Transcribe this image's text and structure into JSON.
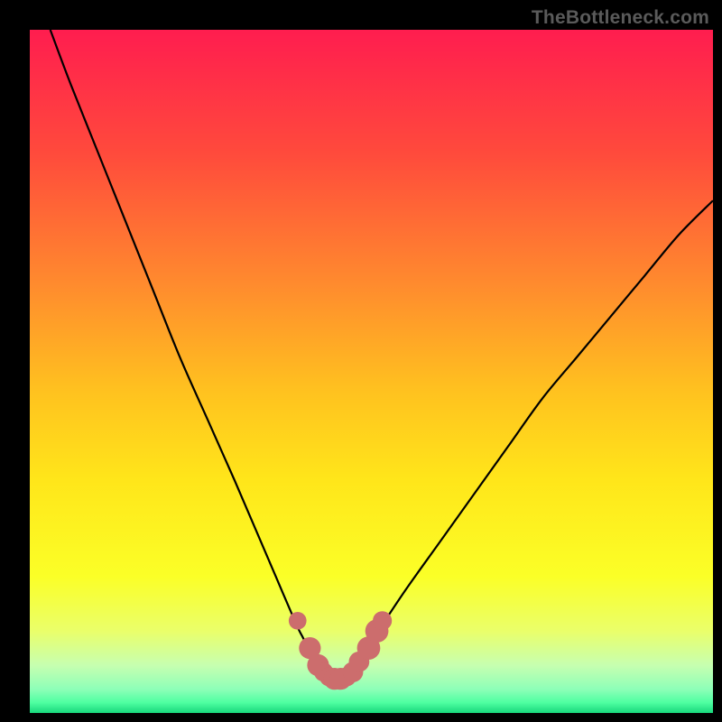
{
  "watermark": "TheBottleneck.com",
  "chart_data": {
    "type": "line",
    "title": "",
    "xlabel": "",
    "ylabel": "",
    "xlim": [
      0,
      100
    ],
    "ylim": [
      0,
      100
    ],
    "grid": false,
    "series": [
      {
        "name": "bottleneck-curve",
        "x": [
          3,
          6,
          10,
          14,
          18,
          22,
          26,
          30,
          33,
          36,
          39,
          40,
          41,
          42,
          43,
          44,
          45,
          46,
          47,
          48,
          49,
          51,
          55,
          60,
          65,
          70,
          75,
          80,
          85,
          90,
          95,
          100
        ],
        "y": [
          100,
          92,
          82,
          72,
          62,
          52,
          43,
          34,
          27,
          20,
          13,
          11,
          9,
          7,
          6,
          5,
          5,
          5,
          6,
          7,
          9,
          12,
          18,
          25,
          32,
          39,
          46,
          52,
          58,
          64,
          70,
          75
        ],
        "color": "#000000"
      }
    ],
    "markers": {
      "name": "highlighted-points",
      "color": "#cc6d6d",
      "points": [
        {
          "x": 39.2,
          "y": 13.5,
          "r": 1.3
        },
        {
          "x": 41.0,
          "y": 9.5,
          "r": 1.6
        },
        {
          "x": 42.2,
          "y": 7.0,
          "r": 1.6
        },
        {
          "x": 43.0,
          "y": 6.0,
          "r": 1.4
        },
        {
          "x": 43.8,
          "y": 5.3,
          "r": 1.4
        },
        {
          "x": 44.6,
          "y": 5.0,
          "r": 1.6
        },
        {
          "x": 45.5,
          "y": 5.0,
          "r": 1.6
        },
        {
          "x": 46.4,
          "y": 5.3,
          "r": 1.4
        },
        {
          "x": 47.3,
          "y": 6.0,
          "r": 1.5
        },
        {
          "x": 48.2,
          "y": 7.5,
          "r": 1.5
        },
        {
          "x": 49.6,
          "y": 9.5,
          "r": 1.7
        },
        {
          "x": 50.8,
          "y": 12.0,
          "r": 1.7
        },
        {
          "x": 51.6,
          "y": 13.5,
          "r": 1.4
        }
      ]
    },
    "background_gradient": {
      "direction": "top-to-bottom",
      "stops": [
        {
          "offset": 0.0,
          "color": "#ff1d4f"
        },
        {
          "offset": 0.18,
          "color": "#ff4a3c"
        },
        {
          "offset": 0.37,
          "color": "#ff8a2e"
        },
        {
          "offset": 0.53,
          "color": "#ffc21f"
        },
        {
          "offset": 0.66,
          "color": "#ffe61a"
        },
        {
          "offset": 0.8,
          "color": "#fbff27"
        },
        {
          "offset": 0.88,
          "color": "#eaff6a"
        },
        {
          "offset": 0.93,
          "color": "#c7ffb0"
        },
        {
          "offset": 0.965,
          "color": "#8effb8"
        },
        {
          "offset": 0.985,
          "color": "#4effa1"
        },
        {
          "offset": 1.0,
          "color": "#18d77b"
        }
      ]
    }
  }
}
